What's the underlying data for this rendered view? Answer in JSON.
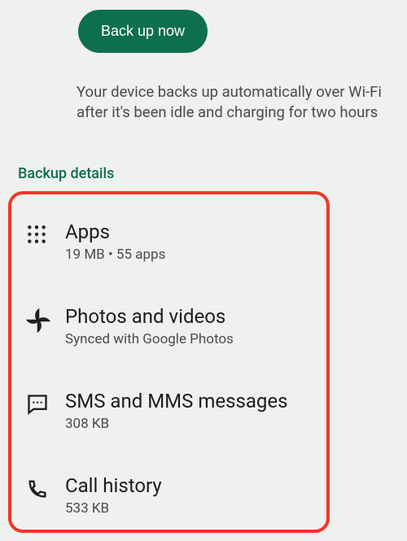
{
  "backup_button": "Back up now",
  "sub_text": "Your device backs up automatically over Wi-Fi after it's been idle and charging for two hours",
  "section_title": "Backup details",
  "items": [
    {
      "title": "Apps",
      "sub": "19 MB • 55 apps"
    },
    {
      "title": "Photos and videos",
      "sub": "Synced with Google Photos"
    },
    {
      "title": "SMS and MMS messages",
      "sub": "308 KB"
    },
    {
      "title": "Call history",
      "sub": "533 KB"
    }
  ]
}
